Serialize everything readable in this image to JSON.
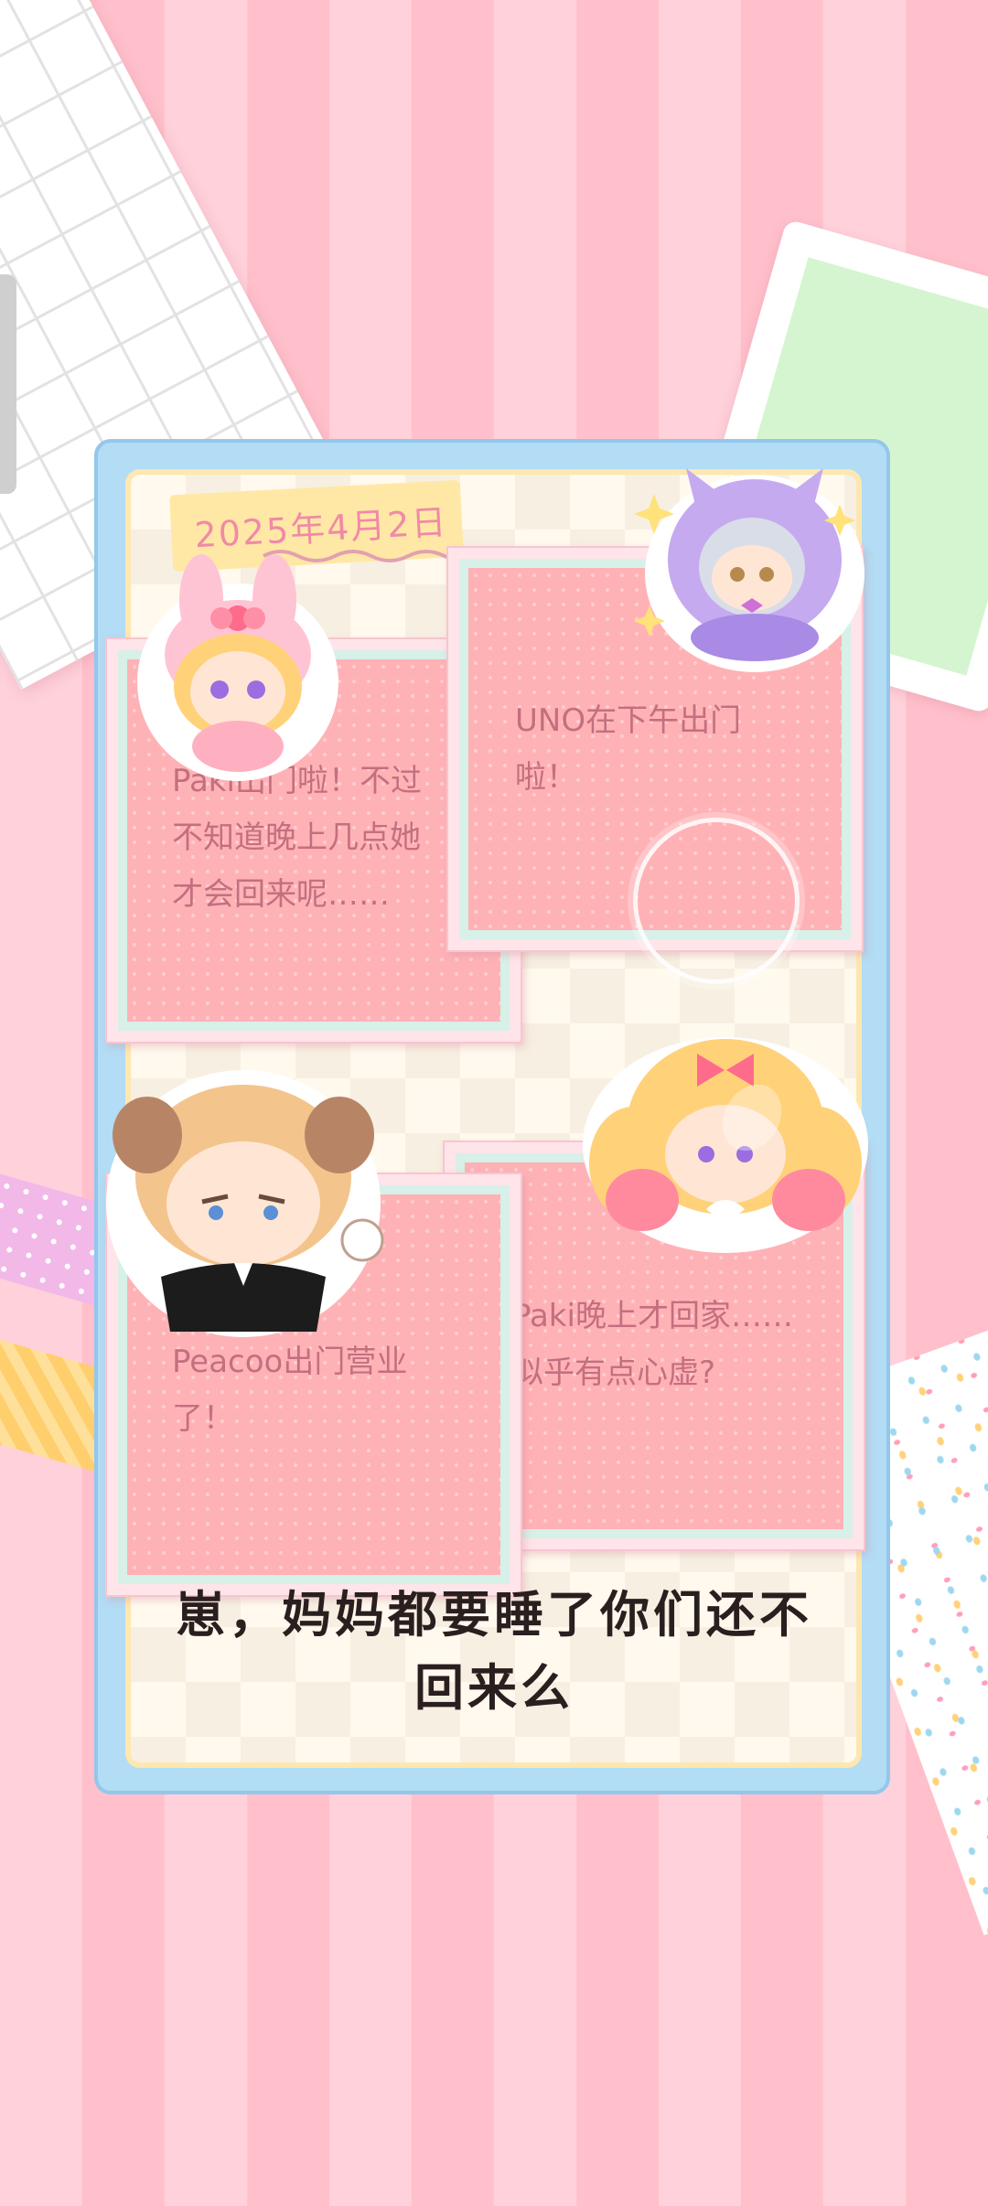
{
  "date_label": "2025年4月2日",
  "notes": [
    {
      "character": "Paki",
      "text": "Paki出门啦！不过不知道晚上几点她才会回来呢……"
    },
    {
      "character": "UNO",
      "text": "UNO在下午出门啦！"
    },
    {
      "character": "Peacoo",
      "text": "Peacoo出门营业了！"
    },
    {
      "character": "Paki",
      "text": "Paki晚上才回家……似乎有点心虚?"
    }
  ],
  "caption": "崽，妈妈都要睡了你们还不回来么",
  "colors": {
    "frame": "#b3dcf5",
    "card": "#ffb2b6",
    "note_text": "#c46f7f",
    "date_text": "#f08aa6"
  }
}
